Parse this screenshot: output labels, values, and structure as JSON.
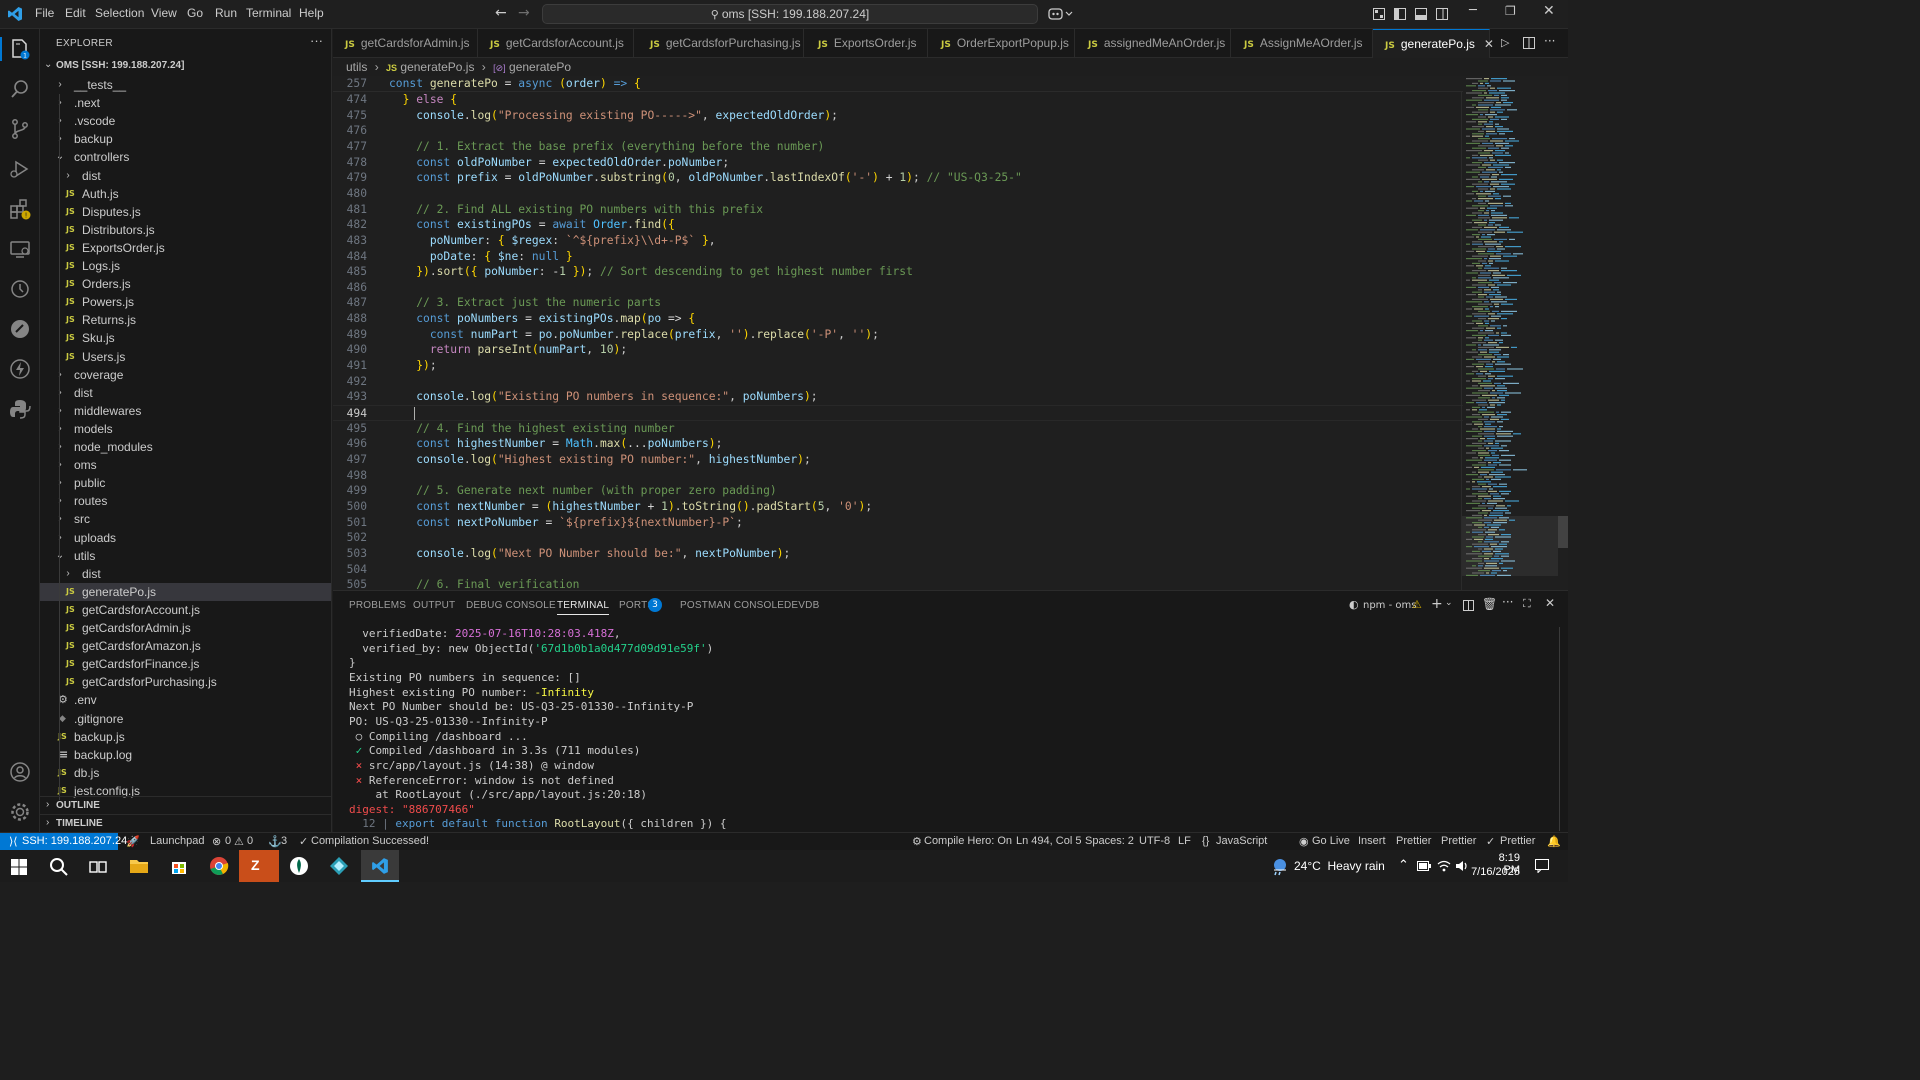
{
  "titlebar": {
    "menu": [
      "File",
      "Edit",
      "Selection",
      "View",
      "Go",
      "Run",
      "Terminal",
      "Help"
    ],
    "search": "oms [SSH: 199.188.207.24]"
  },
  "explorer": {
    "title": "EXPLORER",
    "root": "OMS [SSH: 199.188.207.24]",
    "items": [
      {
        "label": "__tests__",
        "type": "folder",
        "open": false
      },
      {
        "label": ".next",
        "type": "folder",
        "open": false
      },
      {
        "label": ".vscode",
        "type": "folder",
        "open": false
      },
      {
        "label": "backup",
        "type": "folder",
        "open": false
      },
      {
        "label": "controllers",
        "type": "folder",
        "open": true
      },
      {
        "label": "dist",
        "type": "folder",
        "open": false
      },
      {
        "label": "Auth.js",
        "type": "js"
      },
      {
        "label": "Disputes.js",
        "type": "js"
      },
      {
        "label": "Distributors.js",
        "type": "js"
      },
      {
        "label": "ExportsOrder.js",
        "type": "js"
      },
      {
        "label": "Logs.js",
        "type": "js"
      },
      {
        "label": "Orders.js",
        "type": "js"
      },
      {
        "label": "Powers.js",
        "type": "js"
      },
      {
        "label": "Returns.js",
        "type": "js"
      },
      {
        "label": "Sku.js",
        "type": "js"
      },
      {
        "label": "Users.js",
        "type": "js"
      },
      {
        "label": "coverage",
        "type": "folder",
        "open": false
      },
      {
        "label": "dist",
        "type": "folder",
        "open": false
      },
      {
        "label": "middlewares",
        "type": "folder",
        "open": false
      },
      {
        "label": "models",
        "type": "folder",
        "open": false
      },
      {
        "label": "node_modules",
        "type": "folder",
        "open": false
      },
      {
        "label": "oms",
        "type": "folder",
        "open": false
      },
      {
        "label": "public",
        "type": "folder",
        "open": false
      },
      {
        "label": "routes",
        "type": "folder",
        "open": false
      },
      {
        "label": "src",
        "type": "folder",
        "open": false
      },
      {
        "label": "uploads",
        "type": "folder",
        "open": false
      },
      {
        "label": "utils",
        "type": "folder",
        "open": true
      },
      {
        "label": "dist",
        "type": "folder",
        "open": false
      },
      {
        "label": "generatePo.js",
        "type": "js",
        "selected": true
      },
      {
        "label": "getCardsforAccount.js",
        "type": "js"
      },
      {
        "label": "getCardsforAdmin.js",
        "type": "js"
      },
      {
        "label": "getCardsforAmazon.js",
        "type": "js"
      },
      {
        "label": "getCardsforFinance.js",
        "type": "js"
      },
      {
        "label": "getCardsforPurchasing.js",
        "type": "js"
      },
      {
        "label": ".env",
        "type": "gear"
      },
      {
        "label": ".gitignore",
        "type": "diamond"
      },
      {
        "label": "backup.js",
        "type": "js"
      },
      {
        "label": "backup.log",
        "type": "lines"
      },
      {
        "label": "db.js",
        "type": "js"
      },
      {
        "label": "jest.config.js",
        "type": "js"
      }
    ],
    "outline": "OUTLINE",
    "timeline": "TIMELINE"
  },
  "tabs": [
    {
      "label": "getCardsforAdmin.js",
      "active": false
    },
    {
      "label": "getCardsforAccount.js",
      "active": false
    },
    {
      "label": "getCardsforPurchasing.js",
      "active": false
    },
    {
      "label": "ExportsOrder.js",
      "active": false
    },
    {
      "label": "OrderExportPopup.js",
      "active": false
    },
    {
      "label": "assignedMeAnOrder.js",
      "active": false
    },
    {
      "label": "AssignMeAOrder.js",
      "active": false
    },
    {
      "label": "generatePo.js",
      "active": true
    }
  ],
  "breadcrumb": [
    "utils",
    "generatePo.js",
    "generatePo"
  ],
  "sticky": {
    "line": "257",
    "code": "const generatePo = async (order) => {"
  },
  "code_lines": [
    {
      "n": "474",
      "t": "  } else {"
    },
    {
      "n": "475",
      "t": "    console.log(\"Processing existing PO----->\", expectedOldOrder);"
    },
    {
      "n": "476",
      "t": ""
    },
    {
      "n": "477",
      "t": "    // 1. Extract the base prefix (everything before the number)"
    },
    {
      "n": "478",
      "t": "    const oldPoNumber = expectedOldOrder.poNumber;"
    },
    {
      "n": "479",
      "t": "    const prefix = oldPoNumber.substring(0, oldPoNumber.lastIndexOf('-') + 1); // \"US-Q3-25-\""
    },
    {
      "n": "480",
      "t": ""
    },
    {
      "n": "481",
      "t": "    // 2. Find ALL existing PO numbers with this prefix"
    },
    {
      "n": "482",
      "t": "    const existingPOs = await Order.find({"
    },
    {
      "n": "483",
      "t": "      poNumber: { $regex: `^${prefix}\\\\d+-P$` },"
    },
    {
      "n": "484",
      "t": "      poDate: { $ne: null }"
    },
    {
      "n": "485",
      "t": "    }).sort({ poNumber: -1 }); // Sort descending to get highest number first"
    },
    {
      "n": "486",
      "t": ""
    },
    {
      "n": "487",
      "t": "    // 3. Extract just the numeric parts"
    },
    {
      "n": "488",
      "t": "    const poNumbers = existingPOs.map(po => {"
    },
    {
      "n": "489",
      "t": "      const numPart = po.poNumber.replace(prefix, '').replace('-P', '');"
    },
    {
      "n": "490",
      "t": "      return parseInt(numPart, 10);"
    },
    {
      "n": "491",
      "t": "    });"
    },
    {
      "n": "492",
      "t": ""
    },
    {
      "n": "493",
      "t": "    console.log(\"Existing PO numbers in sequence:\", poNumbers);"
    },
    {
      "n": "494",
      "t": "    "
    },
    {
      "n": "495",
      "t": "    // 4. Find the highest existing number"
    },
    {
      "n": "496",
      "t": "    const highestNumber = Math.max(...poNumbers);"
    },
    {
      "n": "497",
      "t": "    console.log(\"Highest existing PO number:\", highestNumber);"
    },
    {
      "n": "498",
      "t": ""
    },
    {
      "n": "499",
      "t": "    // 5. Generate next number (with proper zero padding)"
    },
    {
      "n": "500",
      "t": "    const nextNumber = (highestNumber + 1).toString().padStart(5, '0');"
    },
    {
      "n": "501",
      "t": "    const nextPoNumber = `${prefix}${nextNumber}-P`;"
    },
    {
      "n": "502",
      "t": ""
    },
    {
      "n": "503",
      "t": "    console.log(\"Next PO Number should be:\", nextPoNumber);"
    },
    {
      "n": "504",
      "t": ""
    },
    {
      "n": "505",
      "t": "    // 6. Final verification"
    }
  ],
  "panel": {
    "tabs": [
      "PROBLEMS",
      "OUTPUT",
      "DEBUG CONSOLE",
      "TERMINAL",
      "PORTS",
      "POSTMAN CONSOLE",
      "DEVDB"
    ],
    "ports_badge": "3",
    "terminal_name": "npm - oms",
    "terminal": [
      {
        "t": "  verifiedDate: ",
        "v": "2025-07-16T10:28:03.418Z",
        "e": ","
      },
      {
        "t": "  verified_by: new ObjectId(",
        "v": "'67d1b0b1a0d477d09d91e59f'",
        "e": ")"
      },
      {
        "t": "}"
      },
      {
        "t": "Existing PO numbers in sequence: []"
      },
      {
        "t": "Highest existing PO number: ",
        "y": "-Infinity"
      },
      {
        "t": "Next PO Number should be: US-Q3-25-01330--Infinity-P"
      },
      {
        "t": "PO: US-Q3-25-01330--Infinity-P"
      },
      {
        "t": " ○ Compiling /dashboard ..."
      },
      {
        "t": " ✓ Compiled /dashboard in 3.3s (711 modules)"
      },
      {
        "t": " ⨯ src/app/layout.js (14:38) @ window"
      },
      {
        "t": " ⨯ ReferenceError: window is not defined"
      },
      {
        "t": "    at RootLayout (./src/app/layout.js:20:18)"
      },
      {
        "t": "digest: \"886707466\""
      },
      {
        "t": "  12 | export default function RootLayout({ children }) {"
      }
    ]
  },
  "statusbar": {
    "remote": "SSH: 199.188.207.24",
    "launchpad": "Launchpad",
    "problems": "0",
    "warnings": "0",
    "ports": "3",
    "compile": "Compilation Successed!",
    "compile_hero": "Compile Hero: On",
    "position": "Ln 494, Col 5",
    "spaces": "Spaces: 2",
    "encoding": "UTF-8",
    "eol": "LF",
    "language": "JavaScript",
    "golive": "Go Live",
    "insert": "Insert",
    "prettier1": "Prettier",
    "prettier2": "Prettier",
    "prettier3": "Prettier"
  },
  "taskbar": {
    "weather": "24°C  Heavy rain",
    "time": "8:19 PM",
    "date": "7/16/2025"
  },
  "colors": {
    "accent": "#0078d4",
    "remote_bg": "#16825d",
    "keyword": "#569cd6",
    "string": "#ce9178",
    "comment": "#6a9955"
  }
}
